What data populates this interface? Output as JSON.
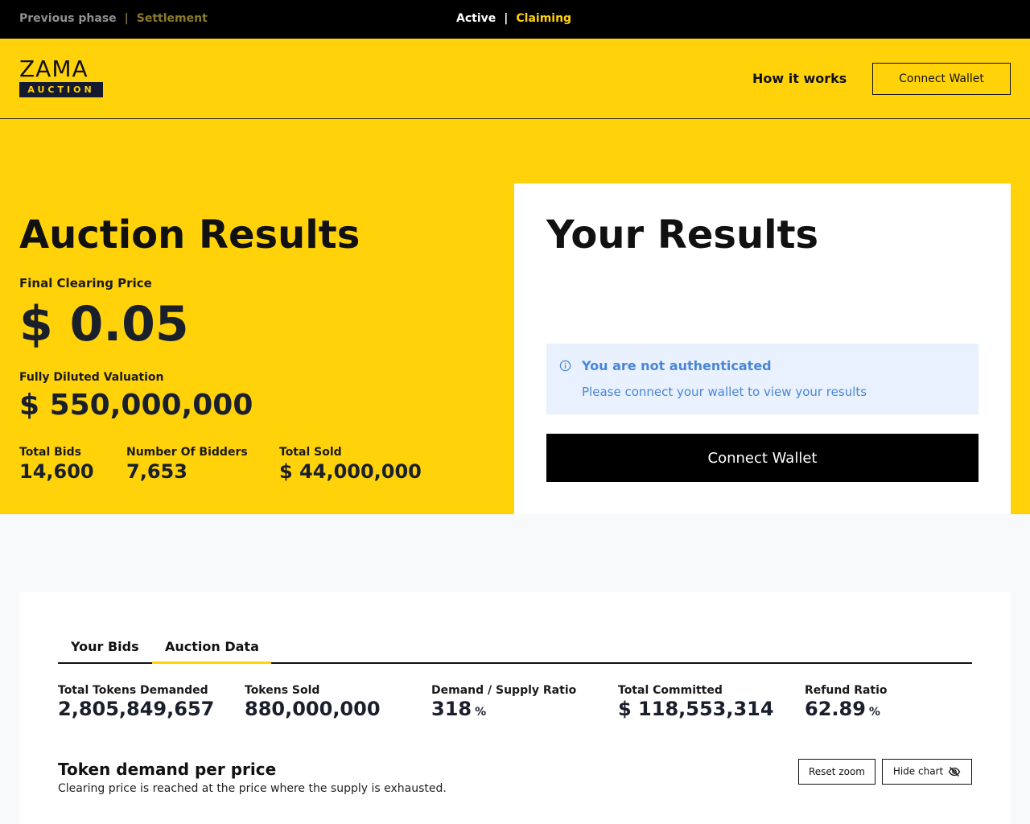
{
  "phasebar": {
    "previous_label": "Previous phase",
    "previous_phase": "Settlement",
    "current_label": "Active",
    "current_phase": "Claiming",
    "separator": "|"
  },
  "header": {
    "logo_word": "ZAMA",
    "logo_tag": "AUCTION",
    "nav_how": "How it works",
    "connect_label": "Connect Wallet"
  },
  "auction_results": {
    "title": "Auction Results",
    "clearing_price_label": "Final Clearing Price",
    "clearing_price": "$ 0.05",
    "fdv_label": "Fully Diluted Valuation",
    "fdv": "$ 550,000,000",
    "stats": [
      {
        "label": "Total Bids",
        "value": "14,600"
      },
      {
        "label": "Number Of Bidders",
        "value": "7,653"
      },
      {
        "label": "Total Sold",
        "value": "$ 44,000,000"
      }
    ]
  },
  "your_results": {
    "title": "Your Results",
    "alert_title": "You are not authenticated",
    "alert_message": "Please connect your wallet to view your results",
    "connect_label": "Connect Wallet"
  },
  "data_panel": {
    "tabs": [
      {
        "label": "Your Bids",
        "active": false
      },
      {
        "label": "Auction Data",
        "active": true
      }
    ],
    "metrics": [
      {
        "label": "Total Tokens Demanded",
        "value": "2,805,849,657",
        "unit": ""
      },
      {
        "label": "Tokens Sold",
        "value": "880,000,000",
        "unit": ""
      },
      {
        "label": "Demand / Supply Ratio",
        "value": "318",
        "unit": "%"
      },
      {
        "label": "Total Committed",
        "value": "$ 118,553,314",
        "unit": ""
      },
      {
        "label": "Refund Ratio",
        "value": "62.89",
        "unit": "%"
      }
    ],
    "chart_title": "Token demand per price",
    "chart_subtitle": "Clearing price is reached at the price where the supply is exhausted.",
    "reset_zoom_label": "Reset zoom",
    "hide_chart_label": "Hide chart"
  },
  "colors": {
    "brand_yellow": "#ffd20a",
    "black": "#000000",
    "alert_bg": "#e8f1fd",
    "alert_text": "#4a86d8",
    "navy": "#151a2e"
  },
  "icons": {
    "alert": "info-icon",
    "hide_chart": "eye-off-icon"
  }
}
